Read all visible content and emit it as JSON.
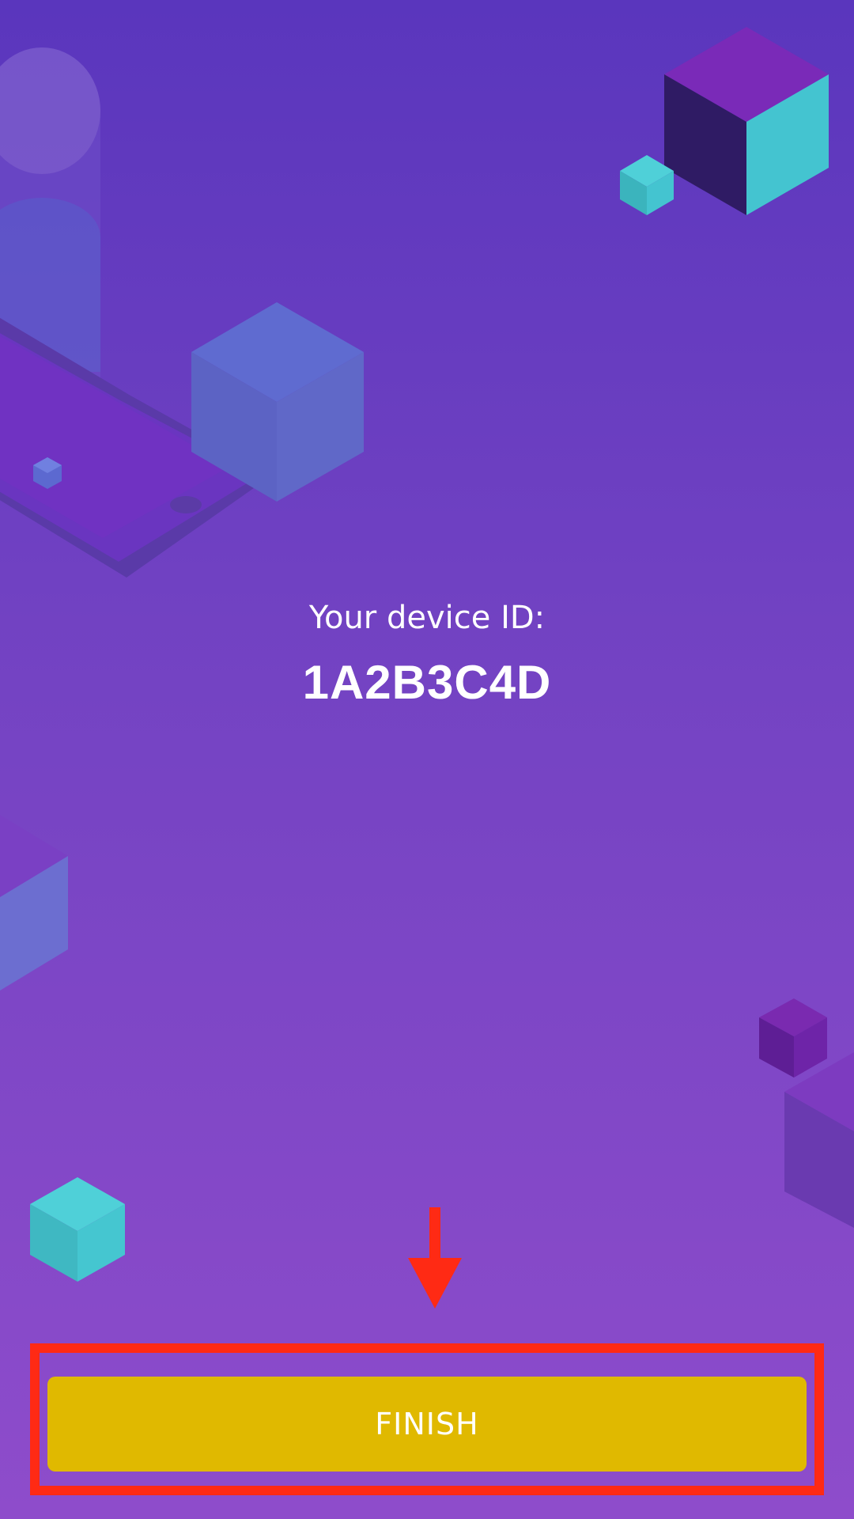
{
  "main": {
    "device_id_label": "Your device ID:",
    "device_id_value": "1A2B3C4D"
  },
  "footer": {
    "finish_label": "FINISH"
  },
  "colors": {
    "background_top": "#5a36bd",
    "background_bottom": "#8e4ccb",
    "button": "#e0b900",
    "annotation": "#ff2a14",
    "text": "#ffffff"
  }
}
